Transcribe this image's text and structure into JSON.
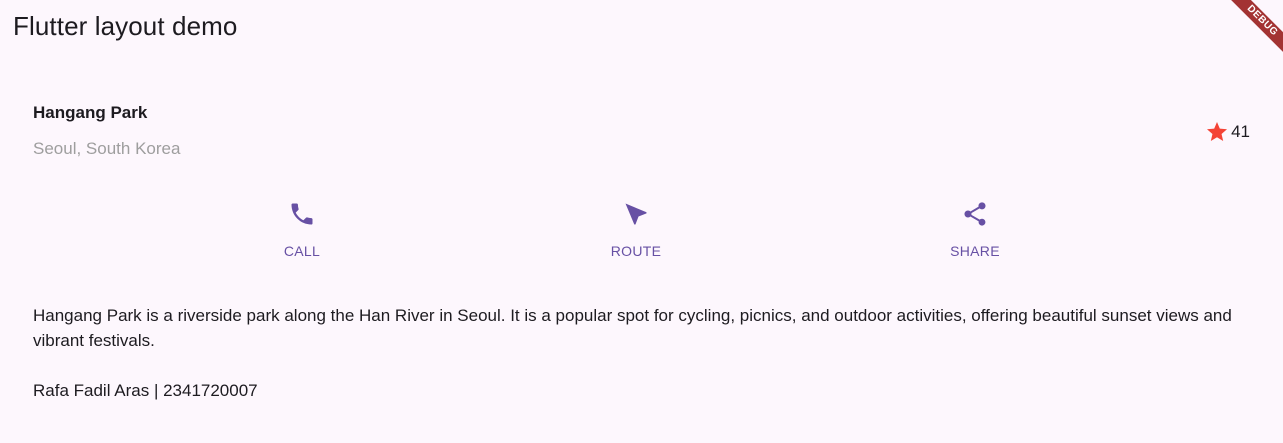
{
  "appbar": {
    "title": "Flutter layout demo",
    "debug_label": "DEBUG"
  },
  "place": {
    "name": "Hangang Park",
    "location": "Seoul, South Korea",
    "rating_count": "41",
    "star_icon": "star-icon"
  },
  "actions": [
    {
      "label": "CALL",
      "icon": "phone-icon"
    },
    {
      "label": "ROUTE",
      "icon": "navigation-icon"
    },
    {
      "label": "SHARE",
      "icon": "share-icon"
    }
  ],
  "description": "Hangang Park is a riverside park along the Han River in Seoul. It is a popular spot for cycling, picnics, and outdoor activities, offering beautiful sunset views and vibrant festivals.",
  "author": "Rafa Fadil Aras | 2341720007",
  "colors": {
    "accent": "#6750a4",
    "star": "#f44336",
    "background": "#fdf7fd",
    "debug_banner": "#a33333",
    "secondary_text": "#9e9e9e"
  }
}
